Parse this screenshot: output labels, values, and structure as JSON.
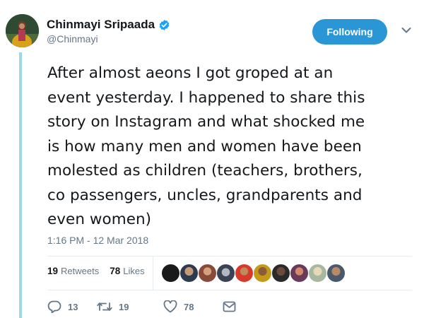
{
  "tweet": {
    "author": {
      "display_name": "Chinmayi Sripaada",
      "handle": "@Chinmayi",
      "verified": true,
      "avatar_icon": "profile-photo"
    },
    "follow_button": {
      "label": "Following"
    },
    "menu_icon": "chevron-down-icon",
    "text": "After almost aeons I got groped at an\nevent yesterday. I happened to share this\nstory on Instagram and what shocked me\nis how many men and women have been\nmolested as children (teachers, brothers,\nco passengers, uncles, grandparents and\neven women)",
    "timestamp": "1:16 PM - 12 Mar 2018",
    "stats": {
      "retweets_count": "19",
      "retweets_label": "Retweets",
      "likes_count": "78",
      "likes_label": "Likes"
    },
    "liker_avatars_count": 10,
    "actions": {
      "reply_count": "13",
      "retweet_count": "19",
      "like_count": "78"
    }
  },
  "colors": {
    "accent": "#2b96d6",
    "thread_line": "#9ed7e6",
    "secondary_text": "#657786",
    "verified": "#1da1f2"
  }
}
